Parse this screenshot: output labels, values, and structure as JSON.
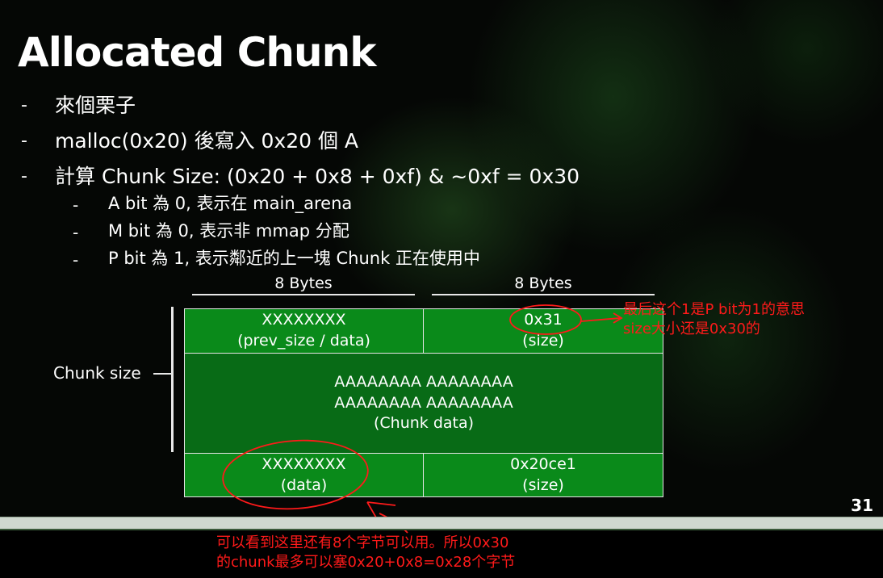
{
  "slide": {
    "title": "Allocated Chunk",
    "page_number": "31",
    "bullets": [
      {
        "dash": "-",
        "text": "來個栗子"
      },
      {
        "dash": "-",
        "text": "malloc(0x20) 後寫入 0x20 個 A"
      },
      {
        "dash": "-",
        "text": "計算 Chunk Size: (0x20 + 0x8 + 0xf) & ~0xf = 0x30"
      }
    ],
    "sub_bullets": [
      {
        "dash": "-",
        "text": "A bit 為 0, 表示在 main_arena"
      },
      {
        "dash": "-",
        "text": "M bit 為 0, 表示非 mmap 分配"
      },
      {
        "dash": "-",
        "text": "P bit 為 1, 表示鄰近的上一塊 Chunk 正在使用中"
      }
    ]
  },
  "diagram": {
    "bytes_left": "8 Bytes",
    "bytes_right": "8 Bytes",
    "chunk_size_label": "Chunk size",
    "cells": {
      "top_left": {
        "line1": "XXXXXXXX",
        "line2": "(prev_size / data)"
      },
      "top_right": {
        "line1": "0x31",
        "line2": "(size)"
      },
      "middle": {
        "line1": "AAAAAAAA AAAAAAAA",
        "line2": "AAAAAAAA AAAAAAAA",
        "line3": "(Chunk data)"
      },
      "bottom_left": {
        "line1": "XXXXXXXX",
        "line2": "(data)"
      },
      "bottom_right": {
        "line1": "0x20ce1",
        "line2": "(size)"
      }
    },
    "colors": {
      "cell_green": "#0a8a1a",
      "middle_green": "#086b16",
      "annotation_red": "#ff1a1a"
    }
  },
  "annotations": {
    "right_line1": "最后这个1是P bit为1的意思",
    "right_line2": "size大小还是0x30的",
    "bottom_line1": "可以看到这里还有8个字节可以用。所以0x30",
    "bottom_line2": "的chunk最多可以塞0x20+0x8=0x28个字节"
  }
}
